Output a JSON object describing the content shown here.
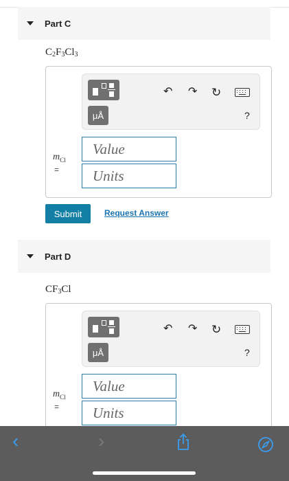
{
  "parts": [
    {
      "title": "Part C",
      "formula": [
        {
          "t": "C"
        },
        {
          "s": "2"
        },
        {
          "t": "F"
        },
        {
          "s": "3"
        },
        {
          "t": "Cl"
        },
        {
          "s": "3"
        }
      ],
      "toolbar": {
        "unit_label": "μÅ",
        "help_label": "?"
      },
      "variable": {
        "symbol": "m",
        "subscript": "Cl",
        "equals": "="
      },
      "value_placeholder": "Value",
      "units_placeholder": "Units",
      "submit_label": "Submit",
      "request_label": "Request Answer"
    },
    {
      "title": "Part D",
      "formula": [
        {
          "t": "CF"
        },
        {
          "s": "3"
        },
        {
          "t": "Cl"
        }
      ],
      "toolbar": {
        "unit_label": "μÅ",
        "help_label": "?"
      },
      "variable": {
        "symbol": "m",
        "subscript": "Cl",
        "equals": "="
      },
      "value_placeholder": "Value",
      "units_placeholder": "Units"
    }
  ],
  "browser": {
    "back_icon": "chevron-left-icon",
    "forward_icon": "chevron-right-icon",
    "share_icon": "share-icon",
    "compass_icon": "compass-icon",
    "accent_color": "#3a9df0"
  },
  "colors": {
    "submit_bg": "#137fa5",
    "link": "#1a73b0",
    "field_border": "#2a7aa8"
  }
}
